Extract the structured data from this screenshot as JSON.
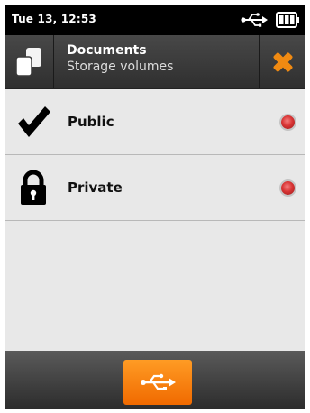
{
  "statusbar": {
    "time": "Tue 13, 12:53",
    "icons": [
      "usb-icon",
      "battery-icon"
    ]
  },
  "header": {
    "app_icon": "documents-icon",
    "title": "Documents",
    "subtitle": "Storage volumes",
    "close_icon": "close-icon"
  },
  "volumes": [
    {
      "label": "Public",
      "icon": "checkmark-icon",
      "radio_color": "#d93535"
    },
    {
      "label": "Private",
      "icon": "lock-icon",
      "radio_color": "#d93535"
    }
  ],
  "bottombar": {
    "button_icon": "usb-icon",
    "accent": "#f47a00"
  }
}
